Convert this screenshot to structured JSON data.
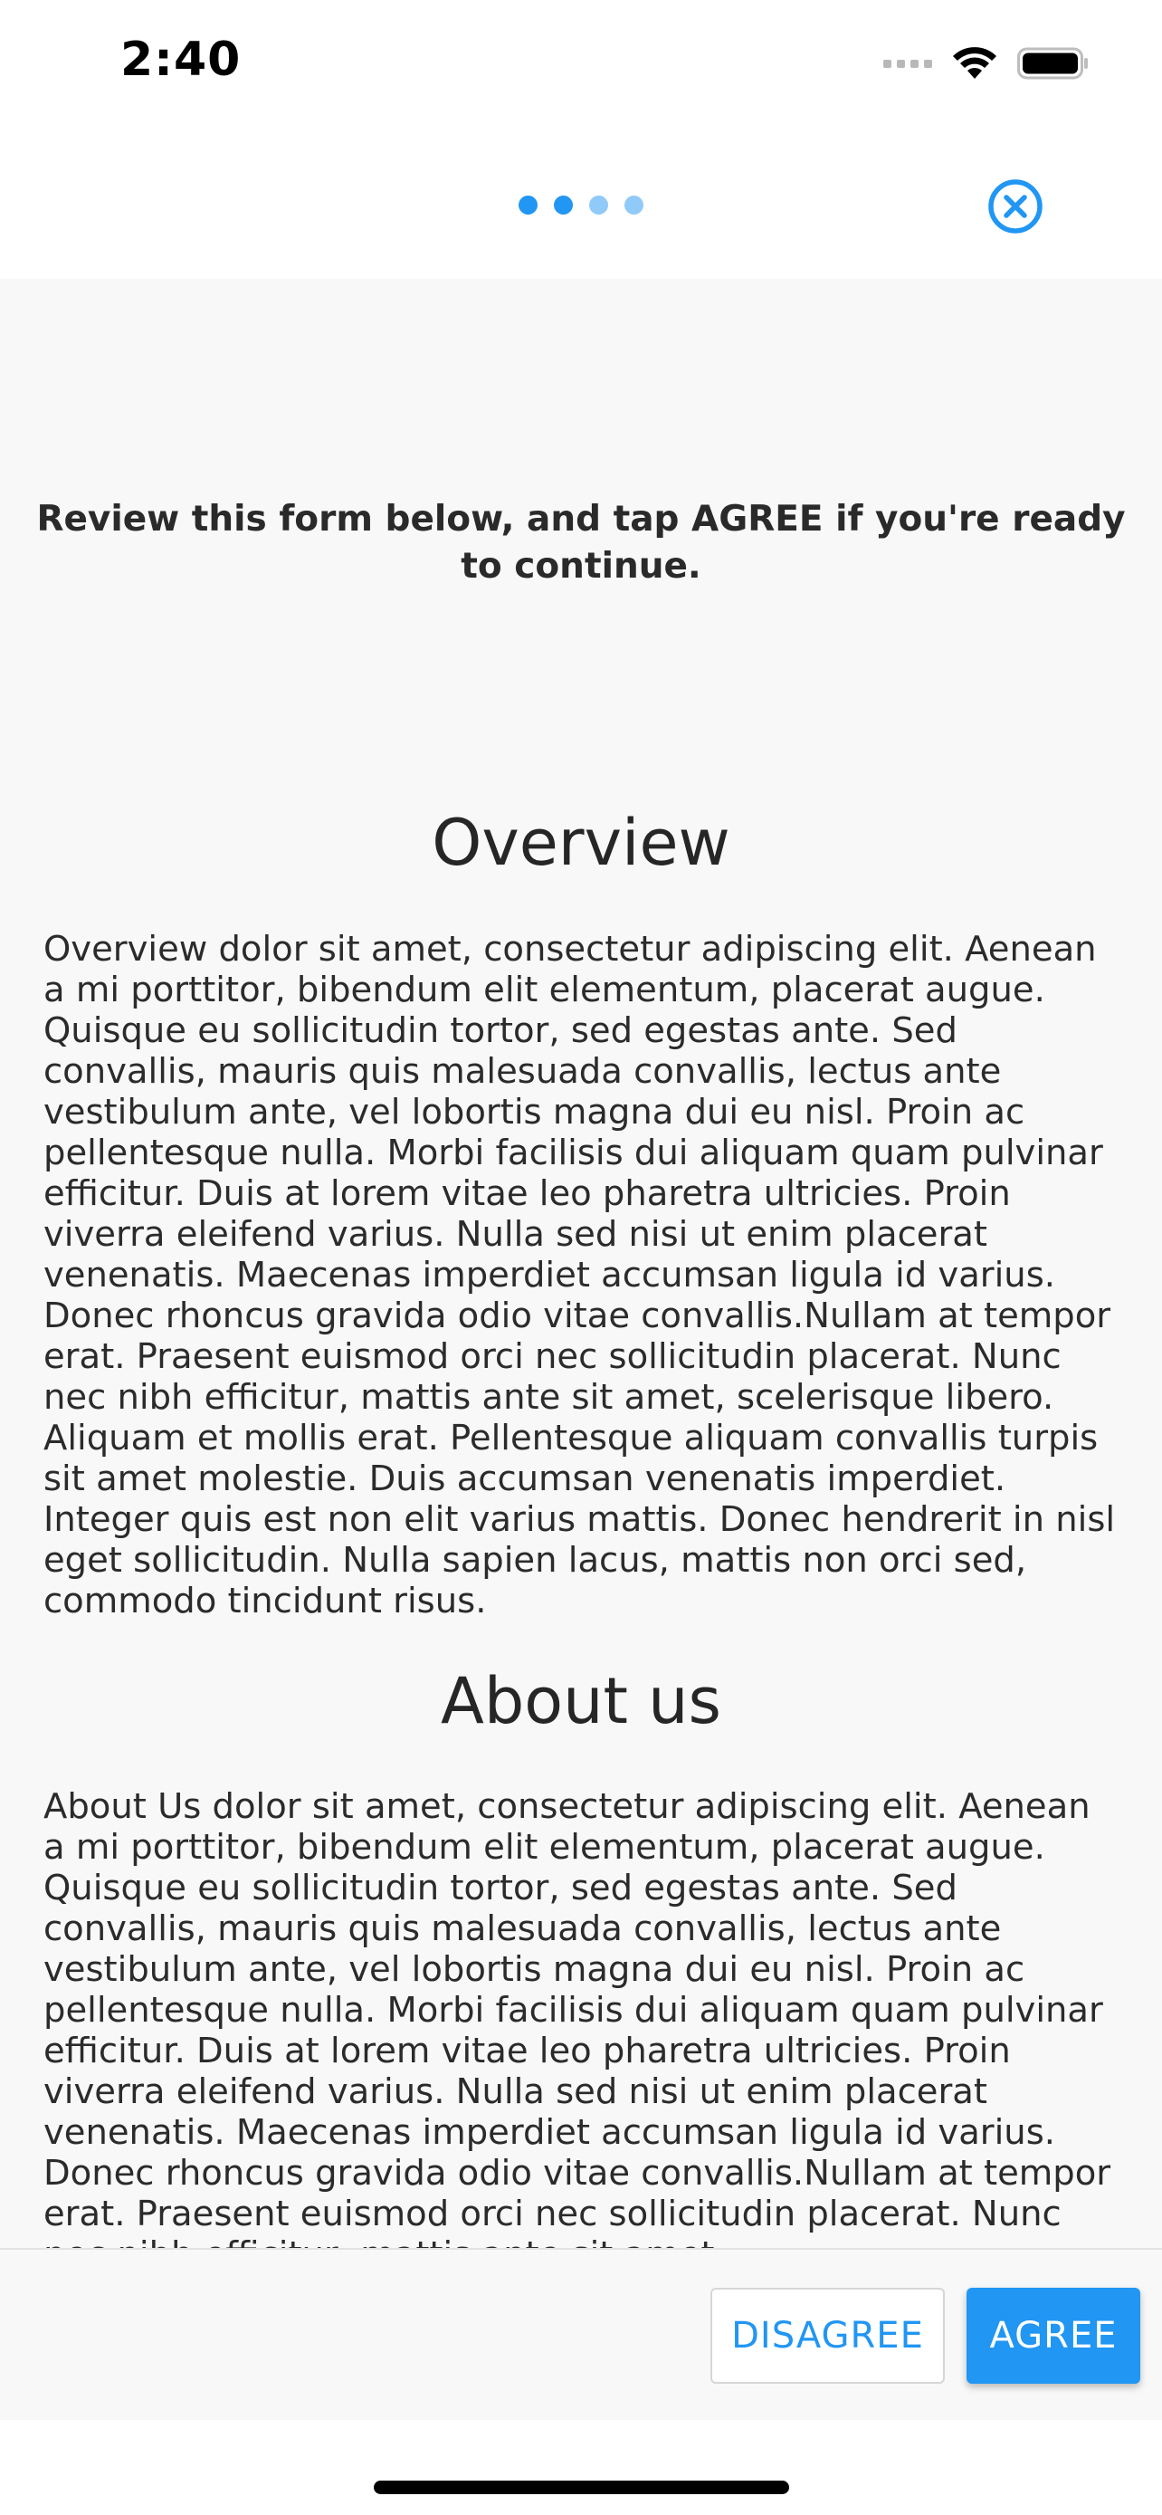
{
  "status_bar": {
    "time": "2:40",
    "icons": [
      "cellular-signal-icon",
      "wifi-icon",
      "battery-icon"
    ]
  },
  "nav": {
    "step_dots": [
      {
        "state": "active",
        "color": "#2196f3"
      },
      {
        "state": "active",
        "color": "#2196f3"
      },
      {
        "state": "inactive",
        "color": "#90caf9"
      },
      {
        "state": "inactive",
        "color": "#90caf9"
      }
    ],
    "close_icon": "close-circle-icon",
    "accent_color": "#2196f3"
  },
  "instruction": "Review this form below, and tap AGREE if you're ready to continue.",
  "sections": {
    "overview": {
      "title": "Overview",
      "body": "Overview dolor sit amet, consectetur adipiscing elit. Aenean a mi porttitor, bibendum elit elementum, placerat augue. Quisque eu sollicitudin tortor, sed egestas ante. Sed convallis, mauris quis malesuada convallis, lectus ante vestibulum ante, vel lobortis magna dui eu nisl. Proin ac pellentesque nulla. Morbi facilisis dui aliquam quam pulvinar efficitur. Duis at lorem vitae leo pharetra ultricies. Proin viverra eleifend varius. Nulla sed nisi ut enim placerat venenatis. Maecenas imperdiet accumsan ligula id varius. Donec rhoncus gravida odio vitae convallis.Nullam at tempor erat. Praesent euismod orci nec sollicitudin placerat. Nunc nec nibh efficitur, mattis ante sit amet, scelerisque libero. Aliquam et mollis erat. Pellentesque aliquam convallis turpis sit amet molestie. Duis accumsan venenatis imperdiet. Integer quis est non elit varius mattis. Donec hendrerit in nisl eget sollicitudin. Nulla sapien lacus, mattis non orci sed, commodo tincidunt risus."
    },
    "about": {
      "title": "About us",
      "body": "About Us dolor sit amet, consectetur adipiscing elit. Aenean a mi porttitor, bibendum elit elementum, placerat augue. Quisque eu sollicitudin tortor, sed egestas ante. Sed convallis, mauris quis malesuada convallis, lectus ante vestibulum ante, vel lobortis magna dui eu nisl. Proin ac pellentesque nulla. Morbi facilisis dui aliquam quam pulvinar efficitur. Duis at lorem vitae leo pharetra ultricies. Proin viverra eleifend varius. Nulla sed nisi ut enim placerat venenatis. Maecenas imperdiet accumsan ligula id varius. Donec rhoncus gravida odio vitae convallis.Nullam at tempor erat. Praesent euismod orci nec sollicitudin placerat. Nunc nec nibh efficitur, mattis ante sit amet,"
    }
  },
  "footer": {
    "disagree_label": "DISAGREE",
    "agree_label": "AGREE"
  }
}
